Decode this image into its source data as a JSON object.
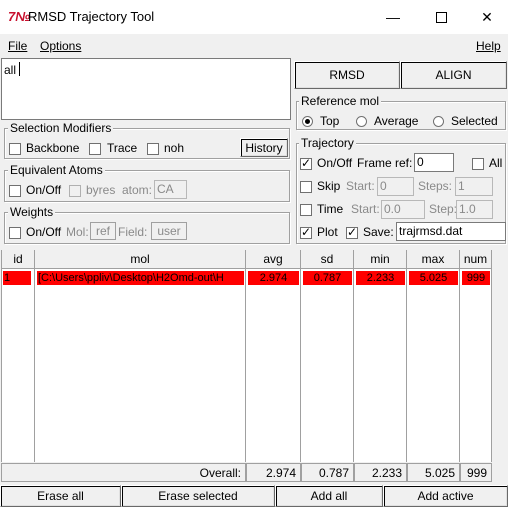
{
  "window": {
    "title": "RMSD Trajectory Tool",
    "icon_glyph": "7№",
    "minimize": "—",
    "maximize": "☐",
    "close": "✕"
  },
  "menu": {
    "file": "File",
    "options": "Options",
    "help": "Help"
  },
  "selection_text": "all",
  "selection_modifiers": {
    "title": "Selection Modifiers",
    "backbone": "Backbone",
    "trace": "Trace",
    "noh": "noh",
    "history": "History"
  },
  "equivalent_atoms": {
    "title": "Equivalent Atoms",
    "onoff": "On/Off",
    "byres": "byres",
    "atom_label": "atom:",
    "atom_value": "CA"
  },
  "weights": {
    "title": "Weights",
    "onoff": "On/Off",
    "mol_label": "Mol:",
    "mol_value": "ref",
    "field_label": "Field:",
    "field_value": "user"
  },
  "actions": {
    "rmsd": "RMSD",
    "align": "ALIGN"
  },
  "reference_mol": {
    "title": "Reference mol",
    "top": "Top",
    "average": "Average",
    "selected": "Selected",
    "selected_option": "Top"
  },
  "trajectory": {
    "title": "Trajectory",
    "onoff": "On/Off",
    "frame_ref_label": "Frame ref:",
    "frame_ref_value": "0",
    "all": "All",
    "skip": "Skip",
    "start_label": "Start:",
    "skip_start": "0",
    "steps_label": "Steps:",
    "steps_value": "1",
    "time": "Time",
    "time_start": "0.0",
    "step_label": "Step:",
    "step_value": "1.0",
    "plot": "Plot",
    "save": "Save:",
    "save_file": "trajrmsd.dat"
  },
  "table": {
    "headers": {
      "id": "id",
      "mol": "mol",
      "avg": "avg",
      "sd": "sd",
      "min": "min",
      "max": "max",
      "num": "num"
    },
    "rows": [
      {
        "id": "1",
        "mol": "[C:\\Users\\ppliv\\Desktop\\H2Omd-out\\H",
        "avg": "2.974",
        "sd": "0.787",
        "min": "2.233",
        "max": "5.025",
        "num": "999"
      }
    ],
    "overall_label": "Overall:",
    "overall": {
      "avg": "2.974",
      "sd": "0.787",
      "min": "2.233",
      "max": "5.025",
      "num": "999"
    }
  },
  "bottom_buttons": {
    "erase_all": "Erase all",
    "erase_selected": "Erase selected",
    "add_all": "Add all",
    "add_active": "Add active"
  },
  "colors": {
    "row_highlight": "#ff0000",
    "app_icon": "#c8102e"
  }
}
